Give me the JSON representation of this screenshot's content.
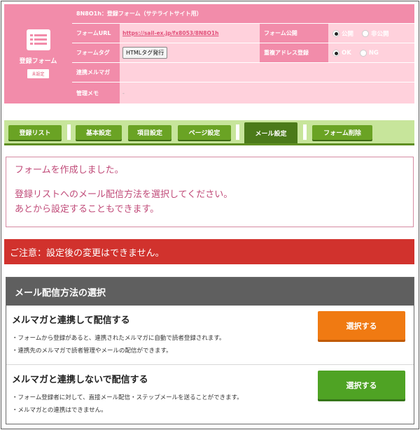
{
  "form_panel": {
    "icon_title": "登録フォーム",
    "badge": "未設定",
    "form_title": "8N8O1h：登録フォーム（サテライトサイト用）",
    "url_label": "フォームURL",
    "url_value": "https://sail-ex.jp/fx8053/8N8O1h",
    "publish_label": "フォーム公開",
    "publish_options": [
      "公開",
      "非公開"
    ],
    "tag_label": "フォームタグ",
    "tag_button": "HTMLタグ発行",
    "dup_label": "重複アドレス登録",
    "dup_options": [
      "OK",
      "NG"
    ],
    "mag_label": "連携メルマガ",
    "memo_label": "管理メモ",
    "memo_value": "-"
  },
  "tabs": [
    "登録リスト",
    "基本設定",
    "項目設定",
    "ページ設定",
    "メール設定",
    "フォーム削除"
  ],
  "active_tab": "メール設定",
  "message": {
    "line1": "フォームを作成しました。",
    "line2": "登録リストへのメール配信方法を選択してください。",
    "line3": "あとから設定することもできます。"
  },
  "notice": "ご注意：設定後の変更はできません。",
  "section": {
    "title": "メール配信方法の選択",
    "options": [
      {
        "title": "メルマガと連携して配信する",
        "bullets": [
          "・フォームから登録があると、連携されたメルマガに自動で読者登録されます。",
          "・連携先のメルマガで読者管理やメールの配信ができます。"
        ],
        "button": "選択する",
        "color": "#f07a12"
      },
      {
        "title": "メルマガと連携しないで配信する",
        "bullets": [
          "・フォーム登録者に対して、直接メール配信・ステップメールを送ることができます。",
          "・メルマガとの連携はできません。"
        ],
        "button": "選択する",
        "color": "#4fa324"
      }
    ]
  },
  "colors": {
    "panel_pink": "#ffd1dc",
    "label_pink": "#f28caa",
    "tab_green": "#6aa324",
    "notice_red": "#d1322d",
    "header_gray": "#5f5f5f"
  }
}
